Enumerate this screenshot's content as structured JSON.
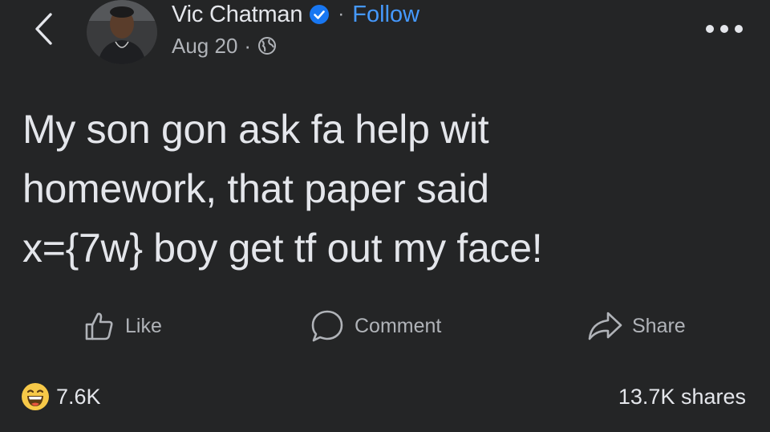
{
  "post": {
    "author": "Vic Chatman",
    "follow_label": "Follow",
    "separator": "·",
    "date": "Aug 20",
    "text": "My son gon ask fa help wit\nhomework, that paper said\nx={7w} boy get tf out my face!"
  },
  "actions": {
    "like": "Like",
    "comment": "Comment",
    "share": "Share"
  },
  "stats": {
    "reactions": "7.6K",
    "shares": "13.7K shares"
  },
  "icons": {
    "back": "chevron-left-icon",
    "verified": "verified-badge-icon",
    "audience": "globe-icon",
    "more": "more-horizontal-icon",
    "reaction": "haha-emoji-icon"
  },
  "colors": {
    "background": "#242526",
    "text": "#e4e6eb",
    "secondary": "#b0b3b8",
    "accent": "#4599ff"
  }
}
